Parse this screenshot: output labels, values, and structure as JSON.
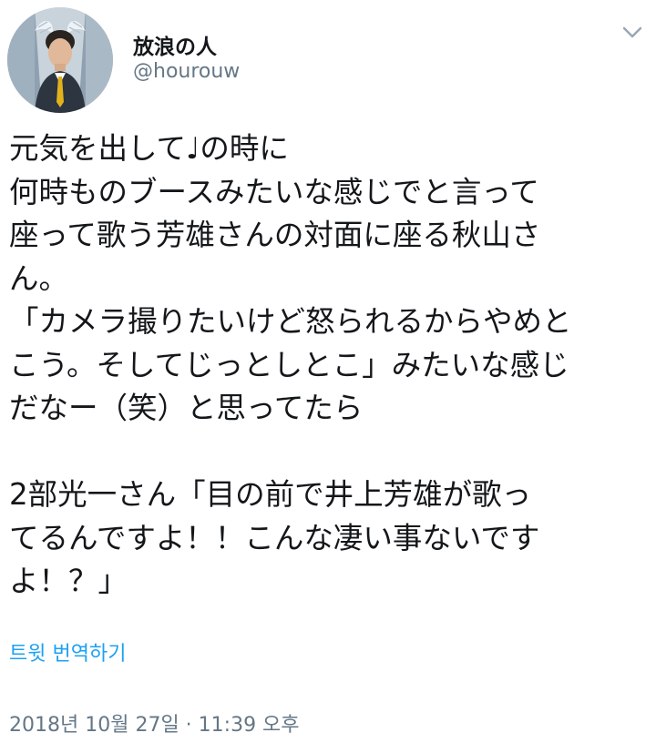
{
  "user": {
    "display_name": "放浪の人",
    "handle": "@hourouw",
    "avatar_icon": "user-avatar-photo"
  },
  "menu": {
    "icon": "chevron-down-icon"
  },
  "tweet": {
    "lines": [
      "元気を出して♩の時に",
      "何時ものブースみたいな感じでと言って",
      "座って歌う芳雄さんの対面に座る秋山さ",
      "ん。",
      "「カメラ撮りたいけど怒られるからやめと",
      "こう。そしてじっとしとこ」みたいな感じ",
      "だなー（笑）と思ってたら",
      "",
      "2部光一さん「目の前で井上芳雄が歌っ",
      "てるんですよ！！こんな凄い事ないです",
      "よ！？」"
    ],
    "translate_label": "트윗 번역하기",
    "timestamp": "2018년 10월 27일 · 11:39 오후"
  },
  "colors": {
    "text": "#14171a",
    "secondary": "#657786",
    "link": "#1da1f2"
  }
}
